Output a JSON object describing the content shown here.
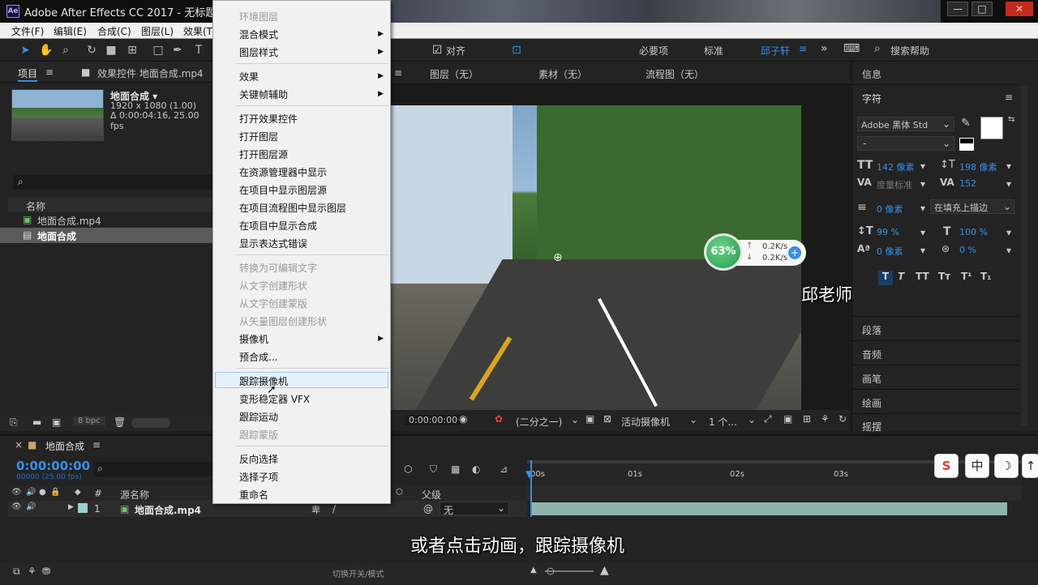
{
  "app": {
    "title": "Adobe After Effects CC 2017 - 无标题项目",
    "icon": "Ae",
    "window_buttons": [
      "—",
      "□",
      "✕"
    ]
  },
  "menubar": [
    "文件(F)",
    "编辑(E)",
    "合成(C)",
    "图层(L)",
    "效果(T"
  ],
  "toolbar": {
    "snap_label": "对齐",
    "workspaces": [
      "必要项",
      "标准",
      "邱子轩"
    ],
    "search_placeholder": "搜索帮助"
  },
  "project_panel": {
    "tab": "项目",
    "effects_tab": "效果控件 地面合成.mp4",
    "selected_name": "地面合成 ▾",
    "selected_info1": "1920 x 1080 (1.00)",
    "selected_info2": "Δ 0:00:04:16, 25.00 fps",
    "column_name": "名称",
    "items": [
      "地面合成.mp4",
      "地面合成"
    ],
    "bpc": "8 bpc"
  },
  "viewer_tabs": {
    "layer": "图层（无）",
    "footage": "素材（无）",
    "flowchart": "流程图（无）"
  },
  "viewer_controls": {
    "timecode": "0:00:00:00",
    "resolution": "(二分之一)",
    "camera": "活动摄像机",
    "views": "1 个..."
  },
  "network_widget": {
    "percent": "63%",
    "up": "0.2K/s",
    "down": "0.2K/s",
    "percent_value": 63
  },
  "watermark": "邱老师中文字幕系列教程",
  "right_panel": {
    "info": "信息",
    "character": "字符",
    "font": "Adobe 黑体 Std",
    "font_style": "-",
    "font_size": "142 像素",
    "leading": "198 像素",
    "kerning": "度量标准",
    "tracking": "152",
    "stroke_width": "0 像素",
    "stroke_type": "在填充上描边",
    "vscale": "99 %",
    "hscale": "100 %",
    "baseline": "0 像素",
    "tsume": "0 %",
    "text_styles": [
      "T",
      "T",
      "TT",
      "Tт",
      "T¹",
      "T₁"
    ],
    "sections": [
      "段落",
      "音频",
      "画笔",
      "绘画",
      "摇摆"
    ]
  },
  "timeline": {
    "comp_tab": "地面合成",
    "timecode": "0:00:00:00",
    "timecode_sub": "00000 (25.00 fps)",
    "col_source": "源名称",
    "col_parent": "父级",
    "layer_number": "1",
    "layer_name": "地面合成.mp4",
    "parent_value": "无",
    "ruler": [
      "00s",
      "01s",
      "02s",
      "03s"
    ],
    "bottom_label": "切换开关/模式"
  },
  "context_menu": [
    {
      "label": "环境图层",
      "disabled": true
    },
    {
      "label": "混合模式",
      "submenu": true
    },
    {
      "label": "图层样式",
      "submenu": true
    },
    {
      "label": "效果",
      "submenu": true
    },
    {
      "label": "关键帧辅助",
      "submenu": true
    },
    {
      "label": "打开效果控件"
    },
    {
      "label": "打开图层"
    },
    {
      "label": "打开图层源"
    },
    {
      "label": "在资源管理器中显示"
    },
    {
      "label": "在项目中显示图层源"
    },
    {
      "label": "在项目流程图中显示图层"
    },
    {
      "label": "在项目中显示合成"
    },
    {
      "label": "显示表达式错误"
    },
    {
      "label": "转换为可编辑文字",
      "disabled": true
    },
    {
      "label": "从文字创建形状",
      "disabled": true
    },
    {
      "label": "从文字创建蒙版",
      "disabled": true
    },
    {
      "label": "从矢量图层创建形状",
      "disabled": true
    },
    {
      "label": "摄像机",
      "submenu": true
    },
    {
      "label": "预合成..."
    },
    {
      "label": "跟踪摄像机",
      "highlighted": true
    },
    {
      "label": "变形稳定器 VFX"
    },
    {
      "label": "跟踪运动"
    },
    {
      "label": "跟踪蒙版",
      "disabled": true
    },
    {
      "label": "反向选择"
    },
    {
      "label": "选择子项"
    },
    {
      "label": "重命名"
    }
  ],
  "subtitle": "或者点击动画，跟踪摄像机",
  "ime": [
    "S",
    "中",
    "☽",
    "↑"
  ],
  "colors": {
    "accent_blue": "#3a8ee6",
    "menu_bg": "#f1f1f1",
    "highlight": "#e5f1fb",
    "panel_bg": "#232323"
  }
}
